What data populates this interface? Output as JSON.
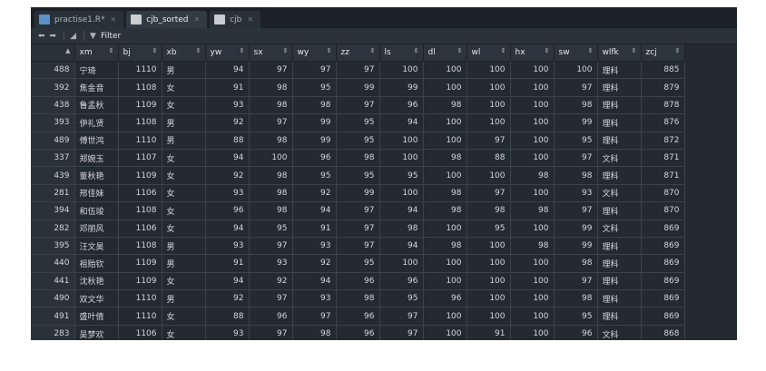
{
  "tabs": [
    {
      "label": "practise1.R*",
      "icon": "r-file-icon",
      "active": false
    },
    {
      "label": "cjb_sorted",
      "icon": "table-icon",
      "active": true
    },
    {
      "label": "cjb",
      "icon": "table-icon",
      "active": false
    }
  ],
  "toolbar": {
    "filter_label": "Filter"
  },
  "columns": [
    "xm",
    "bj",
    "xb",
    "yw",
    "sx",
    "wy",
    "zz",
    "ls",
    "dl",
    "wl",
    "hx",
    "sw",
    "wlfk",
    "zcj"
  ],
  "rows": [
    [
      "488",
      "宁琦",
      "1110",
      "男",
      "94",
      "97",
      "97",
      "97",
      "100",
      "100",
      "100",
      "100",
      "100",
      "理科",
      "885"
    ],
    [
      "392",
      "焦金音",
      "1108",
      "女",
      "91",
      "98",
      "95",
      "99",
      "99",
      "100",
      "100",
      "100",
      "97",
      "理科",
      "879"
    ],
    [
      "438",
      "鲁孟秋",
      "1109",
      "女",
      "93",
      "98",
      "98",
      "97",
      "96",
      "98",
      "100",
      "100",
      "98",
      "理科",
      "878"
    ],
    [
      "393",
      "伊礼贤",
      "1108",
      "男",
      "92",
      "97",
      "99",
      "95",
      "94",
      "100",
      "100",
      "100",
      "99",
      "理科",
      "876"
    ],
    [
      "489",
      "傅世鸿",
      "1110",
      "男",
      "88",
      "98",
      "99",
      "95",
      "100",
      "100",
      "97",
      "100",
      "95",
      "理科",
      "872"
    ],
    [
      "337",
      "郑婉玉",
      "1107",
      "女",
      "94",
      "100",
      "96",
      "98",
      "100",
      "98",
      "88",
      "100",
      "97",
      "文科",
      "871"
    ],
    [
      "439",
      "董秋艳",
      "1109",
      "女",
      "92",
      "98",
      "95",
      "95",
      "95",
      "100",
      "100",
      "98",
      "98",
      "理科",
      "871"
    ],
    [
      "281",
      "邢佳妹",
      "1106",
      "女",
      "93",
      "98",
      "92",
      "99",
      "100",
      "98",
      "97",
      "100",
      "93",
      "文科",
      "870"
    ],
    [
      "394",
      "和伍竣",
      "1108",
      "女",
      "96",
      "98",
      "94",
      "97",
      "94",
      "98",
      "98",
      "98",
      "97",
      "理科",
      "870"
    ],
    [
      "282",
      "邓丽风",
      "1106",
      "女",
      "94",
      "95",
      "91",
      "97",
      "98",
      "100",
      "95",
      "100",
      "99",
      "文科",
      "869"
    ],
    [
      "395",
      "汪文昊",
      "1108",
      "男",
      "93",
      "97",
      "93",
      "97",
      "94",
      "98",
      "100",
      "98",
      "99",
      "理科",
      "869"
    ],
    [
      "440",
      "祖贻钦",
      "1109",
      "男",
      "91",
      "93",
      "92",
      "95",
      "100",
      "100",
      "100",
      "100",
      "98",
      "理科",
      "869"
    ],
    [
      "441",
      "沈秋艳",
      "1109",
      "女",
      "94",
      "92",
      "94",
      "96",
      "96",
      "100",
      "100",
      "100",
      "97",
      "理科",
      "869"
    ],
    [
      "490",
      "双文华",
      "1110",
      "男",
      "92",
      "97",
      "93",
      "98",
      "95",
      "96",
      "100",
      "100",
      "98",
      "理科",
      "869"
    ],
    [
      "491",
      "盛叶倩",
      "1110",
      "女",
      "88",
      "96",
      "97",
      "96",
      "97",
      "100",
      "100",
      "100",
      "95",
      "理科",
      "869"
    ],
    [
      "283",
      "吴梦欢",
      "1106",
      "女",
      "93",
      "97",
      "98",
      "96",
      "97",
      "100",
      "91",
      "100",
      "96",
      "文科",
      "868"
    ]
  ]
}
